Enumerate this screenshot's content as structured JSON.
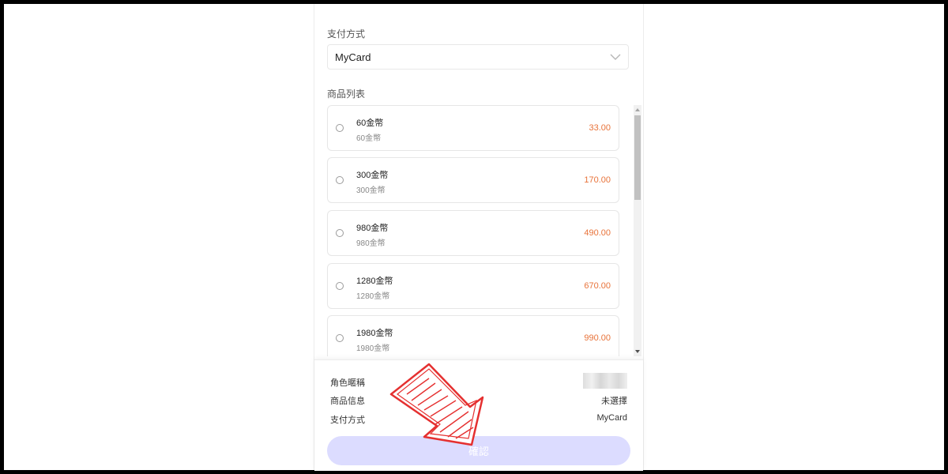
{
  "payment": {
    "label": "支付方式",
    "selected": "MyCard"
  },
  "products": {
    "label": "商品列表",
    "items": [
      {
        "name": "60金幣",
        "desc": "60金幣",
        "price": "33.00"
      },
      {
        "name": "300金幣",
        "desc": "300金幣",
        "price": "170.00"
      },
      {
        "name": "980金幣",
        "desc": "980金幣",
        "price": "490.00"
      },
      {
        "name": "1280金幣",
        "desc": "1280金幣",
        "price": "670.00"
      },
      {
        "name": "1980金幣",
        "desc": "1980金幣",
        "price": "990.00"
      }
    ]
  },
  "summary": {
    "role_label": "角色暱稱",
    "product_label": "商品信息",
    "product_value": "未選擇",
    "payment_label": "支付方式",
    "payment_value": "MyCard"
  },
  "confirm_label": "確認",
  "colors": {
    "price": "#e8733a",
    "confirm_bg": "#dcdcff",
    "annotation_arrow": "#e53030"
  }
}
